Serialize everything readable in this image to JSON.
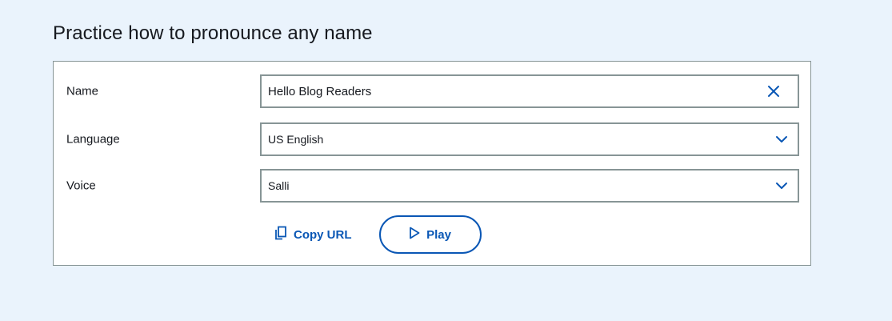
{
  "page": {
    "title": "Practice how to pronounce any name"
  },
  "form": {
    "name": {
      "label": "Name",
      "value": "Hello Blog Readers",
      "clear_icon": "close-icon"
    },
    "language": {
      "label": "Language",
      "selected": "US English",
      "icon": "chevron-down-icon"
    },
    "voice": {
      "label": "Voice",
      "selected": "Salli",
      "icon": "chevron-down-icon"
    }
  },
  "actions": {
    "copy_url_label": "Copy URL",
    "copy_icon": "copy-icon",
    "play_label": "Play",
    "play_icon": "play-icon"
  },
  "colors": {
    "background": "#eaf3fc",
    "accent": "#0a57b5",
    "border": "#879596",
    "text": "#16191f"
  }
}
